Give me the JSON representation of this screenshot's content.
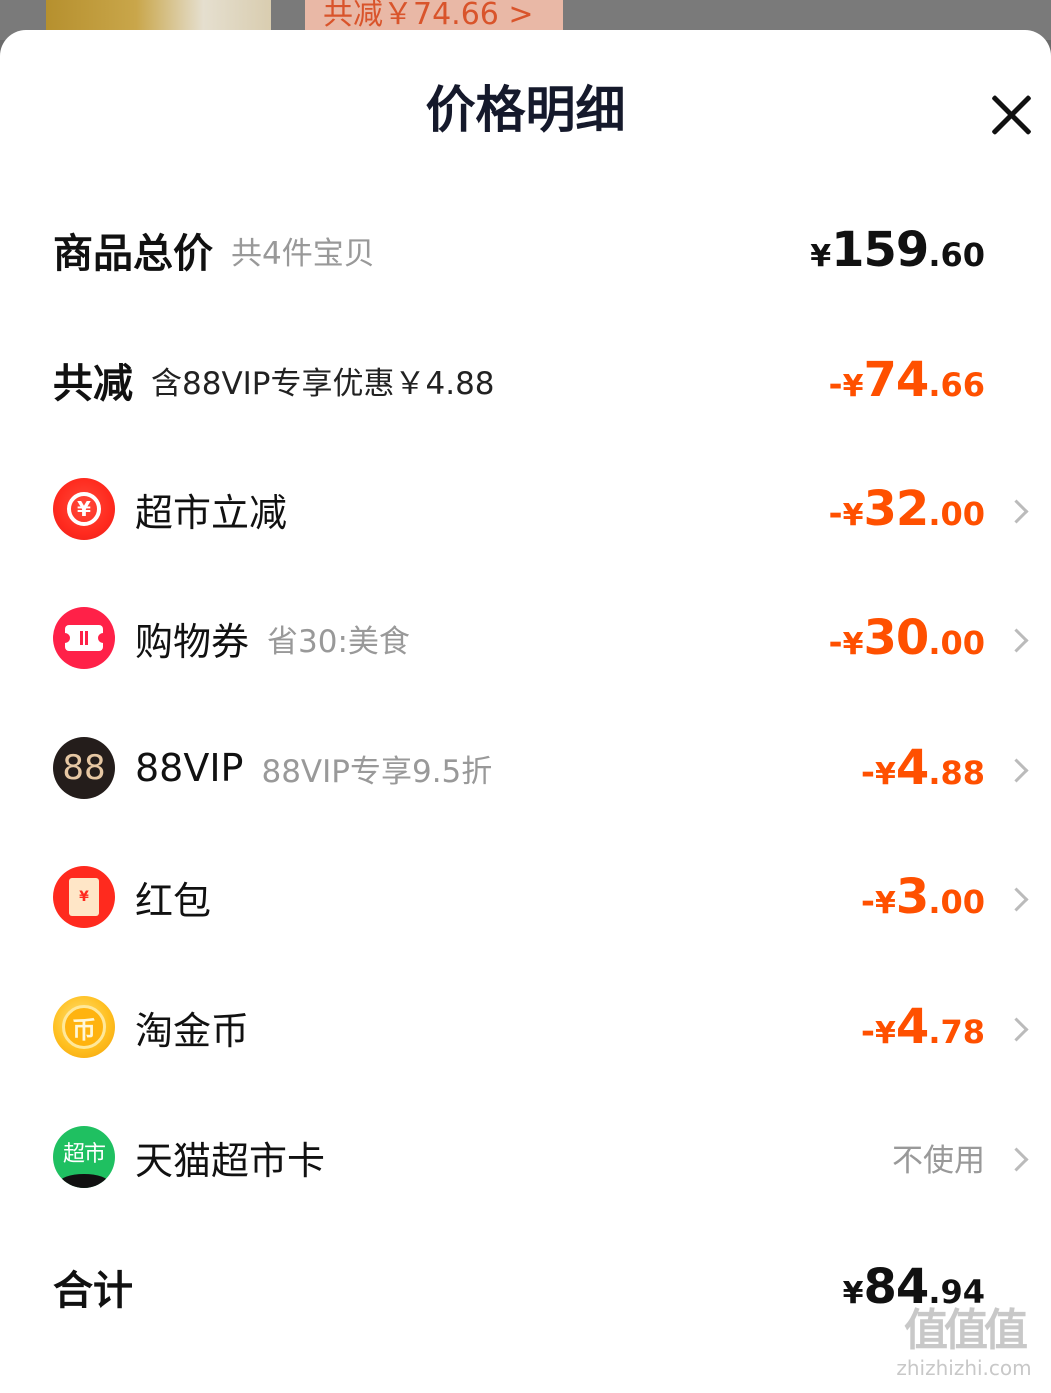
{
  "backdrop": {
    "chip_text": "共减￥74.66 >"
  },
  "sheet": {
    "title": "价格明细"
  },
  "rows": {
    "goods_total": {
      "label": "商品总价",
      "note": "共4件宝贝",
      "amount": {
        "sign": "",
        "currency": "¥",
        "int": "159",
        "dec": ".60"
      }
    },
    "total_discount": {
      "label": "共减",
      "note": "含88VIP专享优惠￥4.88",
      "amount": {
        "sign": "-",
        "currency": "¥",
        "int": "74",
        "dec": ".66"
      }
    },
    "supermarket_discount": {
      "icon": "yuan-return-icon",
      "icon_text": "¥",
      "label": "超市立减",
      "note": "",
      "amount": {
        "sign": "-",
        "currency": "¥",
        "int": "32",
        "dec": ".00"
      }
    },
    "coupon": {
      "icon": "ticket-icon",
      "label": "购物券",
      "note": "省30:美食",
      "amount": {
        "sign": "-",
        "currency": "¥",
        "int": "30",
        "dec": ".00"
      }
    },
    "vip": {
      "icon": "88vip-icon",
      "icon_text": "88",
      "label": "88VIP",
      "note": "88VIP专享9.5折",
      "amount": {
        "sign": "-",
        "currency": "¥",
        "int": "4",
        "dec": ".88"
      }
    },
    "red_packet": {
      "icon": "red-envelope-icon",
      "icon_text": "¥",
      "label": "红包",
      "note": "",
      "amount": {
        "sign": "-",
        "currency": "¥",
        "int": "3",
        "dec": ".00"
      }
    },
    "taojinbi": {
      "icon": "gold-coin-icon",
      "icon_text": "币",
      "label": "淘金币",
      "note": "",
      "amount": {
        "sign": "-",
        "currency": "¥",
        "int": "4",
        "dec": ".78"
      }
    },
    "tmall_card": {
      "icon": "tmall-supermarket-icon",
      "icon_text": "超市",
      "label": "天猫超市卡",
      "note": "",
      "status": "不使用"
    },
    "sum": {
      "label": "合计",
      "amount": {
        "sign": "",
        "currency": "¥",
        "int": "84",
        "dec": ".94"
      }
    }
  },
  "colors": {
    "discount": "#ff5000",
    "title": "#15192b",
    "note": "#999999"
  },
  "watermark": {
    "glyph": "值值值",
    "url": "zhizhizhi.com"
  }
}
